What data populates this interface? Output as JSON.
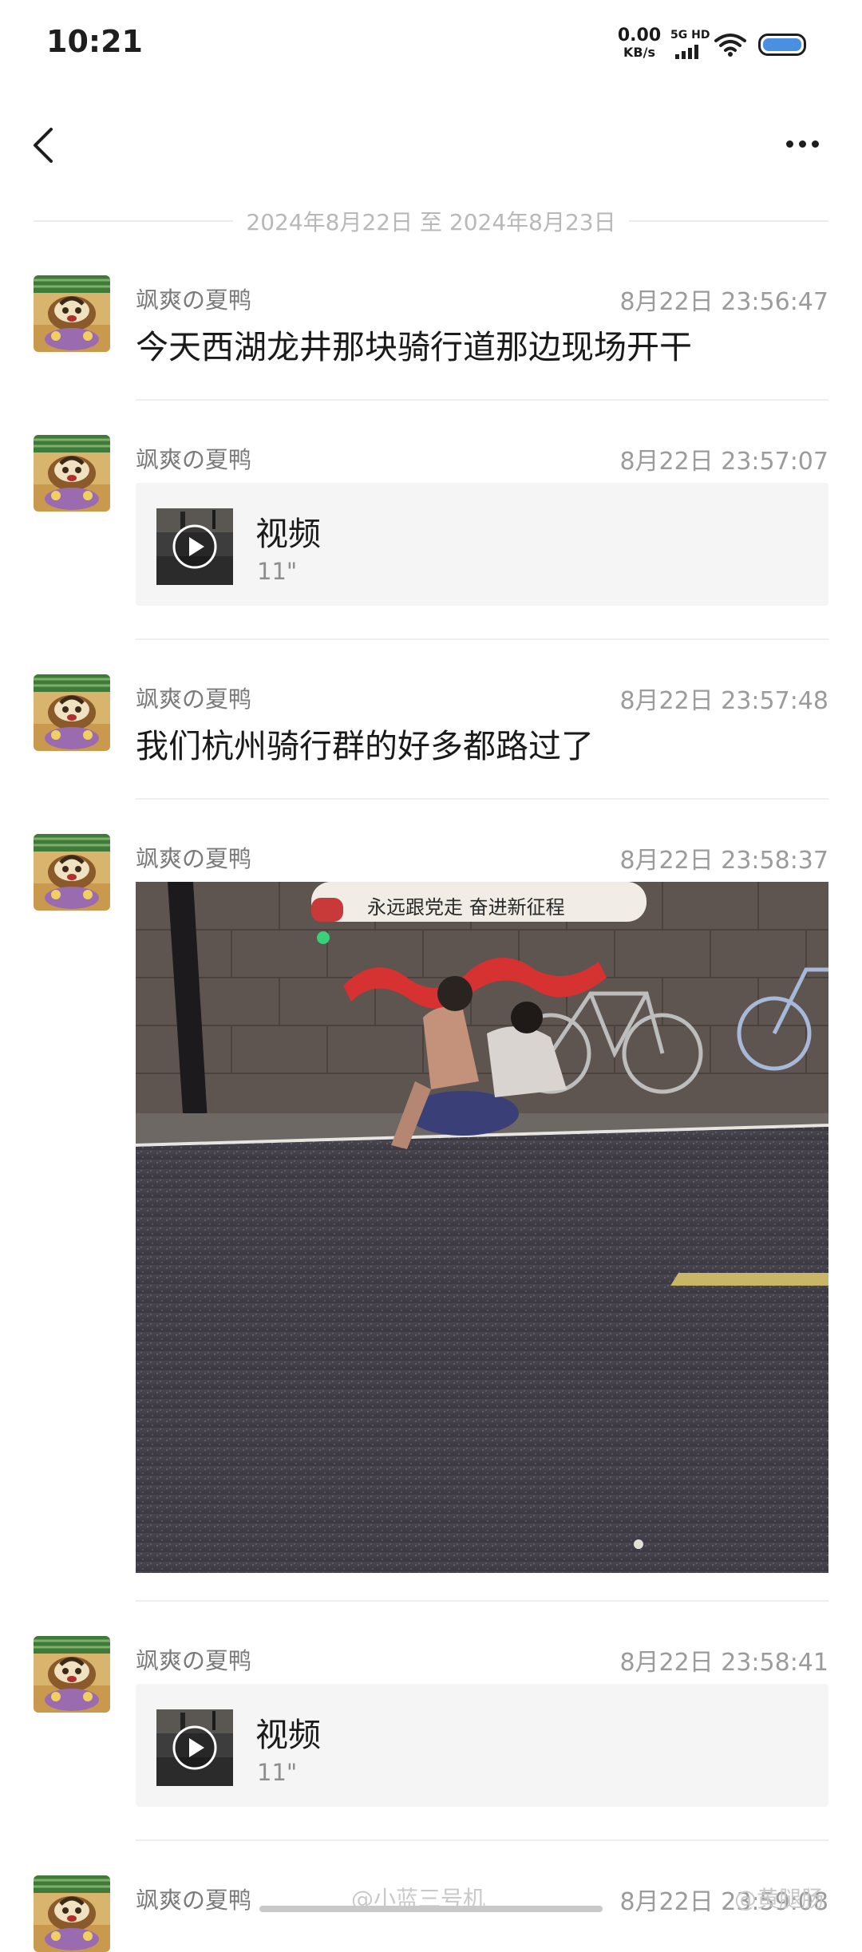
{
  "status_bar": {
    "time": "10:21",
    "net_speed_value": "0.00",
    "net_speed_unit": "KB/s",
    "network_tag": "5G HD",
    "icons": [
      "signal-icon",
      "wifi-icon",
      "battery-icon"
    ]
  },
  "nav": {
    "back_icon": "back-arrow-icon",
    "more_icon": "more-dots-icon"
  },
  "date_range": "2024年8月22日 至 2024年8月23日",
  "messages": [
    {
      "sender": "飒爽の夏鸭",
      "time": "8月22日 23:56:47",
      "type": "text",
      "text": "今天西湖龙井那块骑行道那边现场开干"
    },
    {
      "sender": "飒爽の夏鸭",
      "time": "8月22日 23:57:07",
      "type": "video",
      "video_title": "视频",
      "video_duration": "11\""
    },
    {
      "sender": "飒爽の夏鸭",
      "time": "8月22日 23:57:48",
      "type": "text",
      "text": "我们杭州骑行群的好多都路过了"
    },
    {
      "sender": "飒爽の夏鸭",
      "time": "8月22日 23:58:37",
      "type": "image",
      "banner_text": "永远跟党走 奋进新征程"
    },
    {
      "sender": "飒爽の夏鸭",
      "time": "8月22日 23:58:41",
      "type": "video",
      "video_title": "视频",
      "video_duration": "11\""
    },
    {
      "sender": "飒爽の夏鸭",
      "time": "8月22日 23:59:08",
      "type": "partial"
    }
  ],
  "watermark": {
    "left": "@小蓝三号机",
    "right": "@黄腿肠"
  },
  "colors": {
    "battery_fill": "#4a90e2",
    "background": "#ffffff",
    "card_bg": "#f5f5f5"
  }
}
